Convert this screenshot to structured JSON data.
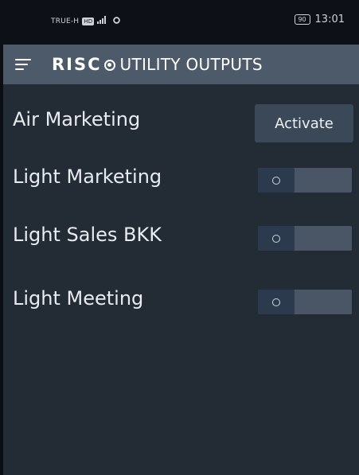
{
  "status_bar": {
    "carrier": "TRUE-H",
    "network_badge": "HD",
    "signal": "4G",
    "battery": "90",
    "time": "13:01"
  },
  "app_bar": {
    "menu_icon": "hamburger-menu-icon",
    "brand": "RISC",
    "brand_mark_icon": "risco-logo-mark-icon",
    "title": "UTILITY OUTPUTS"
  },
  "outputs": [
    {
      "label": "Air Marketing",
      "control": "button",
      "button_label": "Activate"
    },
    {
      "label": "Light Marketing",
      "control": "toggle",
      "state_label": "O",
      "on": false
    },
    {
      "label": "Light Sales BKK",
      "control": "toggle",
      "state_label": "O",
      "on": false
    },
    {
      "label": "Light Meeting",
      "control": "toggle",
      "state_label": "O",
      "on": false
    }
  ],
  "colors": {
    "status_bar_bg": "#0d1117",
    "app_bar_bg": "#4c5a6a",
    "content_bg": "#232b35",
    "button_bg": "#3b4858",
    "toggle_track": "#4a5666",
    "toggle_knob": "#2c3a4d"
  }
}
